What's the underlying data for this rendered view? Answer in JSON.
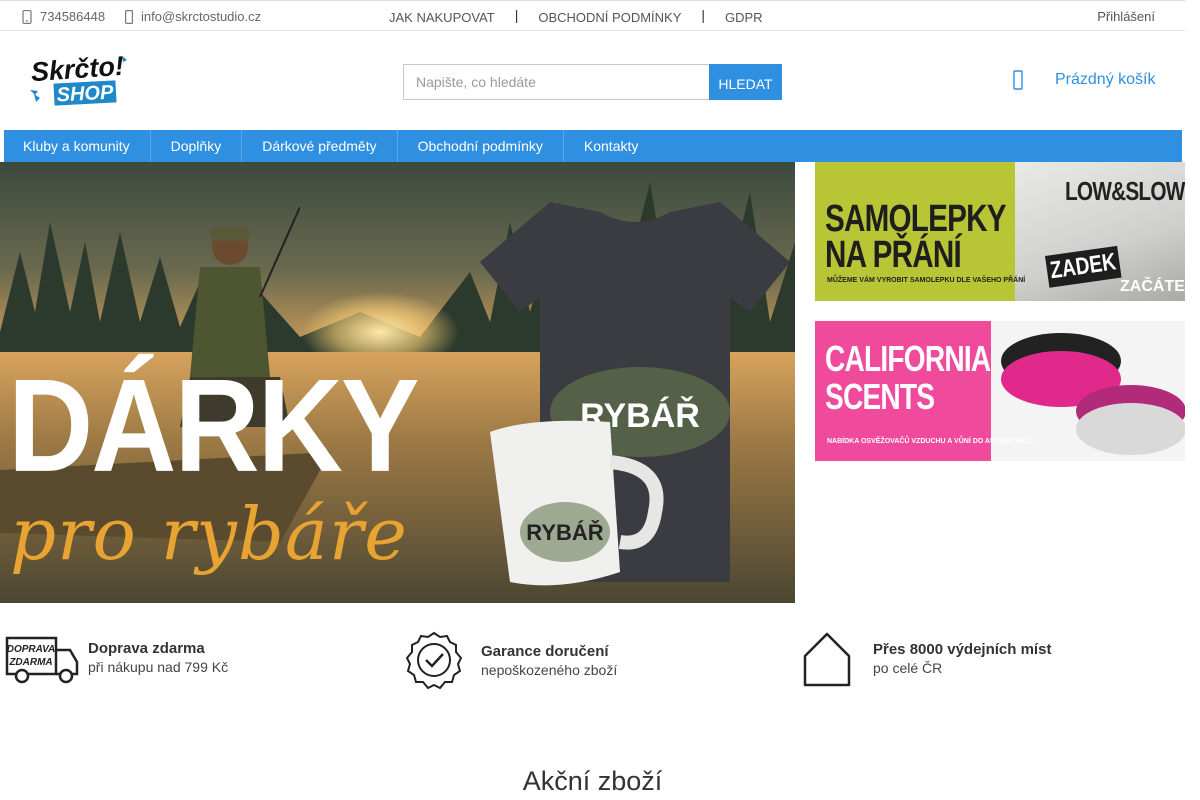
{
  "topbar": {
    "phone": "734586448",
    "email": "info@skrctostudio.cz",
    "links": [
      "JAK NAKUPOVAT",
      "OBCHODNÍ PODMÍNKY",
      "GDPR"
    ],
    "separator": "|",
    "login": "Přihlášení"
  },
  "header": {
    "logo_text_top": "Skrčto!",
    "logo_text_bottom": "SHOP",
    "search_placeholder": "Napište, co hledáte",
    "search_button": "HLEDAT",
    "cart_label": "Prázdný košík"
  },
  "main_nav": [
    "Kluby a komunity",
    "Doplňky",
    "Dárkové předměty",
    "Obchodní podmínky",
    "Kontakty"
  ],
  "hero": {
    "headline": "DÁRKY",
    "subline": "pro rybáře",
    "shirt_text": "RYBÁŘ",
    "mug_text": "RYBÁŘ"
  },
  "banners": [
    {
      "title_line1": "SAMOLEPKY",
      "title_line2": "NA PŘÁNÍ",
      "note": "MŮŽEME VÁM VYROBIT SAMOLEPKU DLE VAŠEHO PŘÁNÍ",
      "photo_text1": "LOW&SLOW",
      "photo_text2": "ZADEK",
      "photo_text3": "ZAČÁTEČ"
    },
    {
      "title_line1": "CALIFORNIA",
      "title_line2": "SCENTS",
      "note": "NABÍDKA OSVĚŽOVAČŮ VZDUCHU A VŮNÍ DO AUTOMOBILU."
    }
  ],
  "features": [
    {
      "icon": "truck-icon",
      "icon_text1": "DOPRAVA",
      "icon_text2": "ZDARMA",
      "title": "Doprava zdarma",
      "subtitle": "při nákupu nad 799 Kč"
    },
    {
      "icon": "badge-check-icon",
      "title": "Garance doručení",
      "subtitle": "nepoškozeného zboží"
    },
    {
      "icon": "home-icon",
      "title": "Přes 8000 výdejních míst",
      "subtitle": "po celé ČR"
    }
  ],
  "section_title": "Akční zboží",
  "colors": {
    "accent": "#2f8fe0",
    "banner_green": "#b8c535",
    "banner_pink": "#ef4a9c",
    "hero_orange": "#e8a332"
  }
}
